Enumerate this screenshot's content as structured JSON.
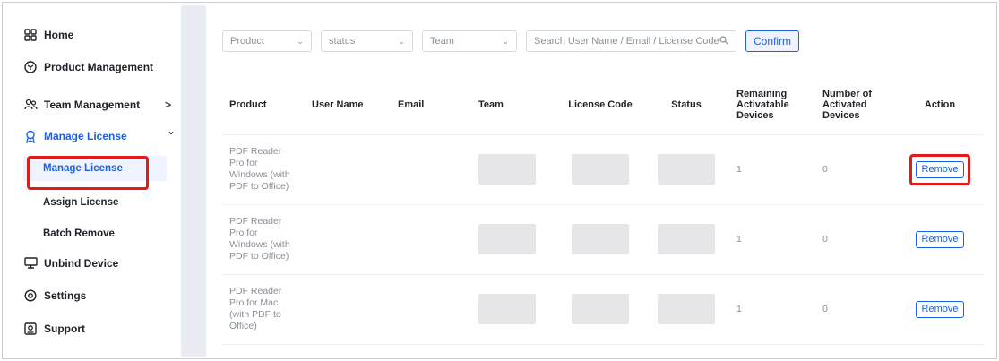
{
  "sidebar": {
    "items": [
      {
        "label": "Home",
        "icon": "grid-icon"
      },
      {
        "label": "Product Management",
        "icon": "cube-icon"
      },
      {
        "label": "Team Management",
        "icon": "team-icon"
      },
      {
        "label": "Manage License",
        "icon": "badge-icon"
      },
      {
        "label": "Unbind Device",
        "icon": "monitor-icon"
      },
      {
        "label": "Settings",
        "icon": "gear-icon"
      },
      {
        "label": "Support",
        "icon": "support-icon"
      }
    ],
    "sub_items": [
      {
        "label": "Manage License"
      },
      {
        "label": "Assign License"
      },
      {
        "label": "Batch Remove"
      }
    ],
    "chevron_right": ">",
    "chevron_down": "⌄"
  },
  "filters": {
    "product": "Product",
    "status": "status",
    "team": "Team",
    "search_placeholder": "Search User Name / Email / License Code",
    "confirm_label": "Confirm",
    "arrow": "⌄"
  },
  "table": {
    "headers": [
      "Product",
      "User Name",
      "Email",
      "Team",
      "License Code",
      "Status",
      "Remaining Activatable Devices",
      "Number of Activated Devices",
      "Action"
    ],
    "rows": [
      {
        "product": "PDF Reader Pro for Windows (with PDF to Office)",
        "remaining": "1",
        "activated": "0",
        "action": "Remove"
      },
      {
        "product": "PDF Reader Pro for Windows (with PDF to Office)",
        "remaining": "1",
        "activated": "0",
        "action": "Remove"
      },
      {
        "product": "PDF Reader Pro for Mac (with PDF to Office)",
        "remaining": "1",
        "activated": "0",
        "action": "Remove"
      }
    ]
  },
  "colors": {
    "accent": "#1d5fe6",
    "highlight": "#e21a1a"
  }
}
